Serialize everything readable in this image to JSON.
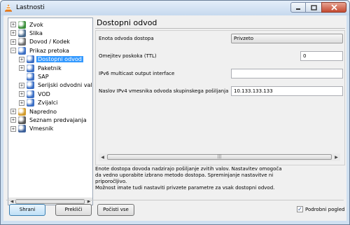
{
  "window": {
    "title": "Lastnosti"
  },
  "tree": {
    "items": [
      {
        "label": "Zvok",
        "expander": "+",
        "icon": "audio-icon",
        "color": "#3a8e3a"
      },
      {
        "label": "Slika",
        "expander": "+",
        "icon": "video-icon",
        "color": "#4a6a8c"
      },
      {
        "label": "Dovod / Kodek",
        "expander": "+",
        "icon": "input-codec-icon",
        "color": "#6c6c6c"
      },
      {
        "label": "Prikaz pretoka",
        "expander": "−",
        "icon": "stream-output-icon",
        "color": "#3a6ec4"
      },
      {
        "label": "Dostopni odvod",
        "expander": "+",
        "icon": "access-output-icon",
        "color": "#3a6ec4",
        "selected": true
      },
      {
        "label": "Paketnik",
        "expander": "+",
        "icon": "muxer-icon",
        "color": "#3a6ec4"
      },
      {
        "label": "SAP",
        "expander": "",
        "icon": "sap-icon",
        "color": "#3a6ec4"
      },
      {
        "label": "Serijski odvodni val",
        "expander": "+",
        "icon": "serial-output-icon",
        "color": "#3a6ec4"
      },
      {
        "label": "VOD",
        "expander": "+",
        "icon": "vod-icon",
        "color": "#3a6ec4"
      },
      {
        "label": "Zvijalci",
        "expander": "+",
        "icon": "packetizer-icon",
        "color": "#3a6ec4"
      },
      {
        "label": "Napredno",
        "expander": "+",
        "icon": "advanced-icon",
        "color": "#d19a2a"
      },
      {
        "label": "Seznam predvajanja",
        "expander": "+",
        "icon": "playlist-icon",
        "color": "#555555"
      },
      {
        "label": "Vmesnik",
        "expander": "+",
        "icon": "interface-icon",
        "color": "#3b5f99"
      }
    ]
  },
  "panel": {
    "title": "Dostopni odvod",
    "fields": {
      "access_filter_label": "Enota odvoda dostopa",
      "access_filter_value": "Privzeto",
      "ttl_label": "Omejitev poskoka (TTL)",
      "ttl_value": "0",
      "ipv6_label": "IPv6 multicast output interface",
      "ipv6_value": "",
      "ipv4_label": "Naslov IPv4 vmesnika odvoda skupinskega pošiljanja",
      "ipv4_value": "10.133.133.133"
    },
    "help_lines": [
      "Enote dostopa dovoda nadzirajo pošiljanje zvitih valov. Nastavitev omogoča",
      "da vedno uporabite izbrano metodo dostopa. Spreminjanje nastavitve ni",
      "priporočljivo.",
      "Možnost imate tudi nastaviti privzete parametre za vsak dostopni odvod."
    ]
  },
  "footer": {
    "save_label": "Shrani",
    "cancel_label": "Prekliči",
    "reset_label": "Počisti vse",
    "advanced_label": "Podrobni pogled",
    "advanced_checked": true
  }
}
